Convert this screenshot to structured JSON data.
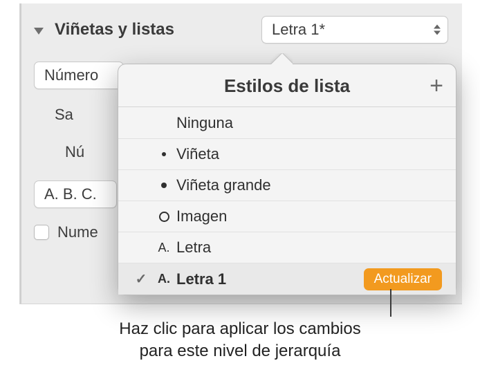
{
  "panel": {
    "section_title": "Viñetas y listas",
    "style_current": "Letra 1*",
    "format_field": "Número",
    "indent_label": "Sa",
    "number_label": "Nú",
    "abc_field": "A. B. C.",
    "checkbox_label": "Nume"
  },
  "popover": {
    "title": "Estilos de lista",
    "add_symbol": "+",
    "items": [
      {
        "label": "Ninguna",
        "bullet": "none",
        "checked": false
      },
      {
        "label": "Viñeta",
        "bullet": "dot",
        "checked": false
      },
      {
        "label": "Viñeta grande",
        "bullet": "bigdot",
        "checked": false
      },
      {
        "label": "Imagen",
        "bullet": "ring",
        "checked": false
      },
      {
        "label": "Letra",
        "bullet": "letterA",
        "checked": false
      },
      {
        "label": "Letra 1",
        "bullet": "letterA",
        "checked": true,
        "update": true
      }
    ],
    "update_label": "Actualizar"
  },
  "callout": {
    "line1": "Haz clic para aplicar los cambios",
    "line2": "para este nivel de jerarquía"
  }
}
